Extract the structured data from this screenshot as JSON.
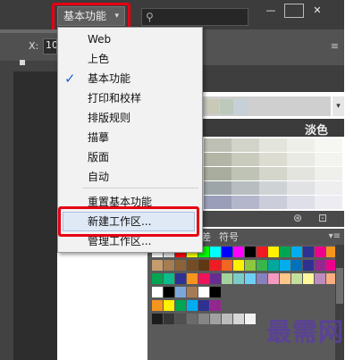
{
  "toolbar": {
    "workspace_label": "基本功能",
    "workspace_chevron": "▾",
    "search_icon": "⚲",
    "minimize": "—",
    "maximize": "□",
    "close": "✕"
  },
  "control": {
    "x_label": "X:",
    "x_value": "10",
    "panel_menu_icon": "≡"
  },
  "workspace_menu": {
    "items": [
      {
        "label": "Web"
      },
      {
        "label": "上色"
      },
      {
        "label": "基本功能",
        "checked": true
      },
      {
        "label": "打印和校样"
      },
      {
        "label": "排版规则"
      },
      {
        "label": "描摹"
      },
      {
        "label": "版面"
      },
      {
        "label": "自动"
      }
    ],
    "actions": [
      {
        "label": "重置基本功能"
      },
      {
        "label": "新建工作区..."
      },
      {
        "label": "管理工作区..."
      }
    ],
    "check_mark": "✓",
    "highlighted": "新建工作区..."
  },
  "color_guide": {
    "column_label": "淡色",
    "dropdown": "▾"
  },
  "swatch_panel": {
    "tab_label": "符号",
    "tab_partial": "差",
    "menu_icon": "▾≡"
  },
  "tool_icons": {
    "icon_1": "⊛",
    "icon_2": "⊡"
  },
  "watermark": "最需网"
}
